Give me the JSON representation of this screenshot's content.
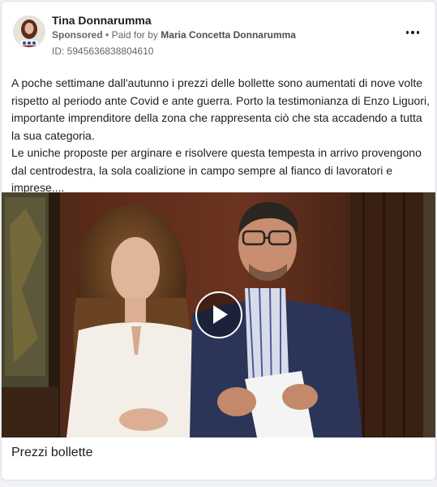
{
  "post": {
    "page_name": "Tina Donnarumma",
    "sponsored_label": "Sponsored",
    "separator": "•",
    "paid_for_prefix": "Paid for by",
    "paid_for_by": "Maria Concetta Donnarumma",
    "ad_id": "ID: 5945636838804610",
    "body_paragraphs": [
      "A poche settimane dall'autunno i prezzi delle bollette sono aumentati di nove volte rispetto al periodo ante Covid e ante guerra. Porto la testimonianza di Enzo Liguori, importante imprenditore della zona che rappresenta ciò che sta accadendo a tutta la sua categoria.",
      "Le uniche proposte per arginare e risolvere questa tempesta in arrivo provengono dal centrodestra, la sola coalizione in campo sempre al fianco di lavoratori e imprese...."
    ],
    "media_caption": "Prezzi bollette"
  },
  "icons": {
    "more": "more-options-icon",
    "play": "play-icon"
  },
  "colors": {
    "text_primary": "#1c1e21",
    "text_secondary": "#65676b",
    "card_border": "#dcdfe4"
  }
}
